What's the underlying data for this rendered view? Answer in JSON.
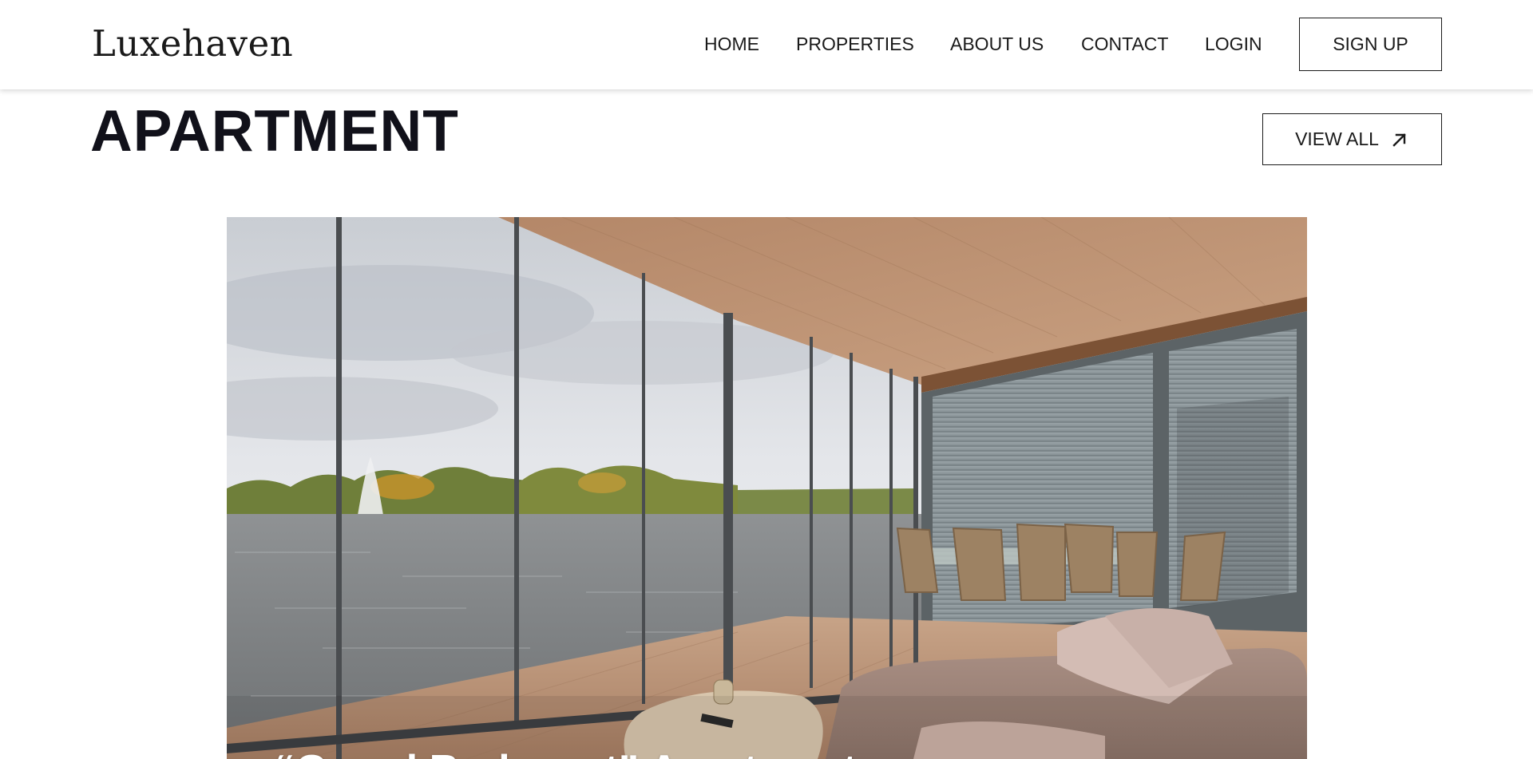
{
  "brand": {
    "logo": "Luxehaven"
  },
  "nav": {
    "links": [
      "HOME",
      "PROPERTIES",
      "ABOUT US",
      "CONTACT",
      "LOGIN"
    ],
    "signup_label": "SIGN UP"
  },
  "section": {
    "heading": "APARTMENT",
    "view_all_label": "VIEW ALL",
    "view_all_icon": "arrow-up-right-icon"
  },
  "featured": {
    "image_description_icon": "apartment-photo",
    "caption": "“Grand Budapest” Apartment"
  },
  "colors": {
    "text": "#11111a",
    "background": "#ffffff",
    "border": "#1a1a1a"
  }
}
